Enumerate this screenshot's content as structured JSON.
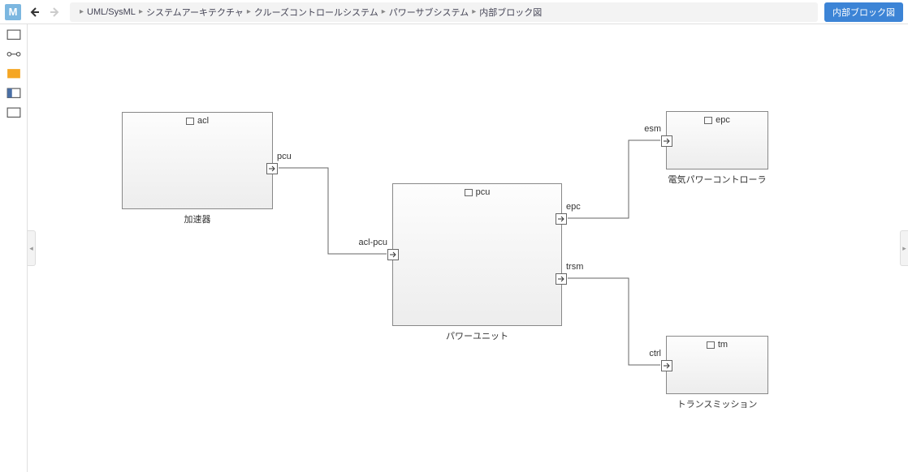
{
  "app": {
    "logo_letter": "M"
  },
  "breadcrumbs": [
    "UML/SysML",
    "システムアーキテクチャ",
    "クルーズコントロールシステム",
    "パワーサブシステム",
    "内部ブロック図"
  ],
  "header": {
    "diagram_type_label": "内部ブロック図"
  },
  "blocks": {
    "acl": {
      "name": "acl",
      "caption": "加速器",
      "ports": {
        "pcu": "pcu"
      }
    },
    "pcu": {
      "name": "pcu",
      "caption": "パワーユニット",
      "ports": {
        "acl_pcu": "acl-pcu",
        "epc": "epc",
        "trsm": "trsm"
      }
    },
    "epc": {
      "name": "epc",
      "caption": "電気パワーコントローラ",
      "ports": {
        "esm": "esm"
      }
    },
    "tm": {
      "name": "tm",
      "caption": "トランスミッション",
      "ports": {
        "ctrl": "ctrl"
      }
    }
  },
  "connectors": [
    {
      "from": "acl.pcu",
      "to": "pcu.acl_pcu"
    },
    {
      "from": "pcu.epc",
      "to": "epc.esm"
    },
    {
      "from": "pcu.trsm",
      "to": "tm.ctrl"
    }
  ]
}
